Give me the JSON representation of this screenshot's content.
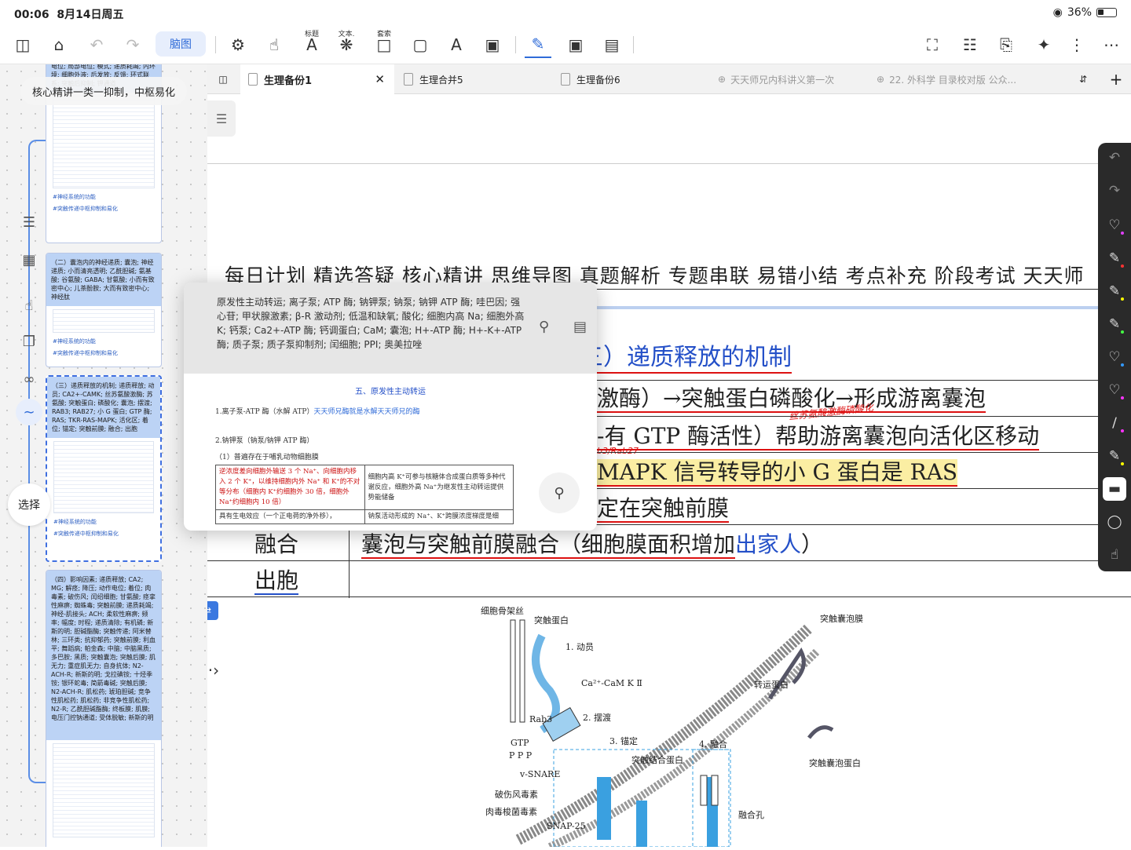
{
  "status_bar": {
    "time": "00:06",
    "date": "8月14日周五",
    "battery": "36%"
  },
  "toolbar": {
    "mindmap_label": "脑图",
    "mini_labels": [
      "标题",
      "文本.",
      "套索"
    ]
  },
  "mindmap": {
    "title": "核心精讲一类一抑制，中枢易化"
  },
  "thumb_cards": [
    {
      "head": "电位; 局部电位; 模式; 递质耗竭; 内环境; 细胞外液; 后发放; 反馈; 环式联系; 突触后抑制; 钾通道",
      "foot1": "#神经系统的功能",
      "foot2": "#突触传递中枢抑制和易化"
    },
    {
      "head": "（二）囊泡内的神经递质; 囊泡; 神经递质; 小而清亮透明; 乙酰胆碱; 氨基酸; 谷氨酸; GABA; 甘氨酸; 小而有致密中心; 儿茶酚胺; 大而有致密中心; 神经肽",
      "foot1": "#神经系统的功能",
      "foot2": "#突触传递中枢抑制和易化"
    },
    {
      "head": "（三）递质释放的机制; 递质释放; 动员; CA2+-CAMK; 丝苏氨酸激酶; 苏氨酸; 突触蛋白; 磷酸化; 囊泡; 摆渡; RAB3; RAB27; 小 G 蛋白; GTP 酶; RAS; TKR-RAS-MAPK; 活化区; 着位; 锚定; 突触前膜; 融合; 出胞",
      "foot1": "#神经系统的功能",
      "foot2": "#突触传递中枢抑制和易化"
    },
    {
      "head": "（四）影响因素; 递质释放; CA2; MG; 解痉; 降压; 动作电位; 着位; 肉毒素; 破伤风; 闰绍细胞; 甘氨酸; 痉挛性麻痹; 蜘蛛毒; 突触前膜; 递质耗竭; 神经-肌接头; ACH; 柔软性麻痹; 频率; 幅度; 时程; 递质清除; 有机磷; 新斯的明; 胆碱酯酶; 突触传递; 阿米替林; 三环类; 抗抑郁药; 突触前膜; 利血平; 舞蹈病; 帕金森; 中脑; 中脑黑质; 多巴胺; 黑质; 突触囊泡; 突触后膜; 肌无力; 重症肌无力; 自身抗体; N2-ACH-R; 新斯的明; 戈拉碘铵; 十烃季铵; 银环蛇毒; 简箭毒碱; 突触后膜; N2-ACH-R; 肌松药; 琥珀胆碱; 竞争性肌松药; 肌松药; 非竞争性肌松药; N2-R; 乙酰胆碱酯酶; 终板膜; 肌膜; 电压门控钠通道; 受体脱敏; 新斯的明",
      "foot1": "",
      "foot2": ""
    }
  ],
  "left_tools": {
    "select_label": "选择"
  },
  "tabs": [
    {
      "label": "生理备份1",
      "active": true
    },
    {
      "label": "生理合并5",
      "active": false
    },
    {
      "label": "生理备份6",
      "active": false
    },
    {
      "label": "天天师兄内科讲义第一次",
      "active": false
    },
    {
      "label": "22. 外科学 目录校对版 公众...",
      "active": false
    }
  ],
  "doc": {
    "nav_row": "每日计划 精选答疑 核心精讲 思维导图 真题解析 专题串联 易错小结 考点补充 阶段考试 天天师",
    "section_title": "三）递质释放的机制",
    "rows": [
      {
        "text": "激酶）→突触蛋白磷酸化→形成游离囊泡"
      },
      {
        "text": "-有 GTP 酶活性）帮助游离囊泡向活化区移动"
      },
      {
        "text": "MAPK 信号转导的小 G 蛋白是 RAS"
      },
      {
        "text": "定在突触前膜"
      },
      {
        "label": "融合",
        "text": "囊泡与突触前膜融合（细胞膜面积增加",
        "text_blue": "出家人",
        "text_end": "）"
      },
      {
        "label": "出胞",
        "text": ""
      }
    ],
    "handwriting_1": "丝苏氨酸激酶磷酸化",
    "handwriting_2": "b3/Rab27"
  },
  "popup": {
    "keywords": "原发性主动转运; 离子泵; ATP 酶; 钠钾泵; 钠泵; 钠钾 ATP 酶; 哇巴因; 强心苷; 甲状腺激素; β-R 激动剂; 低温和缺氧; 酸化; 细胞内高 Na; 细胞外高 K; 钙泵; Ca2+-ATP 酶; 钙调蛋白; CaM; 囊泡; H+-ATP 酶; H+-K+-ATP 酶; 质子泵; 质子泵抑制剂; 闰细胞; PPI; 奥美拉唑",
    "heading": "五、原发性主动转运",
    "line1": "1.离子泵-ATP 酶（水解 ATP）",
    "line1_blue": "天天师兄酶就是水解天天师兄的酶",
    "line2": "2.钠钾泵（钠泵/钠钾 ATP 酶）",
    "line3": "（1）普遍存在于哺乳动物细胞膜",
    "cell_a": "逆浓度差向细胞外输送 3 个 Na⁺、向细胞内移入 2 个 K⁺，以维持细胞内外 Na⁺ 和 K⁺的不对等分布（细胞内 K⁺约细胞外 30 倍，细胞外 Na⁺约细胞内 10 倍）",
    "cell_b": "细胞内高 K⁺可参与核糖体合成蛋白质等多种代谢反应，细胞外高 Na⁺为继发性主动转运提供势能储备",
    "cell_c": "具有生电效应（一个正电荷的净外移），",
    "cell_d": "钠泵活动形成的 Na⁺、K⁺跨膜浓度梯度是细"
  },
  "diagram": {
    "labels": [
      "细胞骨架丝",
      "突触蛋白",
      "1. 动员",
      "Ca²⁺-CaM K Ⅱ",
      "Rab3",
      "2. 摆渡",
      "GTP",
      "P P P",
      "3. 锚定",
      "4. 融合",
      "突触结合蛋白",
      "v-SNARE",
      "破伤风毒素",
      "肉毒梭菌毒素",
      "SNAP-25",
      "融合孔",
      "突触囊泡膜",
      "转运蛋白",
      "突触囊泡蛋白"
    ]
  },
  "colors": {
    "accent": "#2f6bd8",
    "highlight": "#fbeea3",
    "underline_red": "#d11111",
    "thumb_head": "#bcd3f5"
  }
}
